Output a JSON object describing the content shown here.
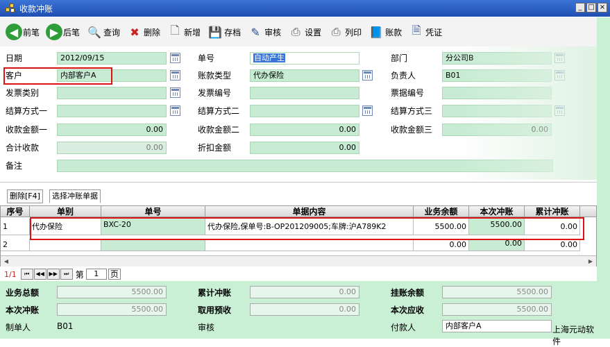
{
  "window": {
    "title": "收款冲账"
  },
  "toolbar": {
    "prev": "前笔",
    "next": "后笔",
    "query": "查询",
    "delete": "删除",
    "new": "新增",
    "save": "存档",
    "review": "审核",
    "settings": "设置",
    "print": "列印",
    "ledger": "账款",
    "voucher": "凭证"
  },
  "form": {
    "date_label": "日期",
    "date_value": "2012/09/15",
    "no_label": "单号",
    "no_value": "自动产生",
    "dept_label": "部门",
    "dept_value": "分公司B",
    "customer_label": "客户",
    "customer_value": "内部客户A",
    "acct_type_label": "账款类型",
    "acct_type_value": "代办保险",
    "owner_label": "负责人",
    "owner_value": "B01",
    "invoice_type_label": "发票类别",
    "invoice_type_value": "",
    "invoice_no_label": "发票编号",
    "invoice_no_value": "",
    "bill_no_label": "票据编号",
    "bill_no_value": "",
    "settle1_label": "结算方式一",
    "settle1_value": "",
    "settle2_label": "结算方式二",
    "settle2_value": "",
    "settle3_label": "结算方式三",
    "settle3_value": "",
    "amt1_label": "收款金额一",
    "amt1_value": "0.00",
    "amt2_label": "收款金额二",
    "amt2_value": "0.00",
    "amt3_label": "收款金额三",
    "amt3_value": "0.00",
    "total_label": "合计收款",
    "total_value": "0.00",
    "discount_label": "折扣金额",
    "discount_value": "0.00",
    "remark_label": "备注",
    "remark_value": ""
  },
  "tabs": {
    "delete_tab": "删除[F4]",
    "select_tab": "选择冲账单据"
  },
  "grid": {
    "headers": [
      "序号",
      "单别",
      "单号",
      "单据内容",
      "业务余额",
      "本次冲账",
      "累计冲账"
    ],
    "rows": [
      {
        "seq": "1",
        "type": "代办保险",
        "no": "BXC-20",
        "content": "代办保险,保单号:B-OP201209005;车牌:沪A789K2",
        "balance": "5500.00",
        "this": "5500.00",
        "cum": "0.00"
      },
      {
        "seq": "2",
        "type": "",
        "no": "",
        "content": "",
        "balance": "0.00",
        "this": "0.00",
        "cum": "0.00"
      }
    ]
  },
  "pager": {
    "page_text": "1/1",
    "di": "第",
    "page": "1",
    "ye": "页"
  },
  "summary": {
    "biz_total_label": "业务总额",
    "biz_total_value": "5500.00",
    "cum_label": "累计冲账",
    "cum_value": "0.00",
    "hang_label": "挂账余额",
    "hang_value": "5500.00",
    "this_label": "本次冲账",
    "this_value": "5500.00",
    "prepay_label": "取用预收",
    "prepay_value": "0.00",
    "due_label": "本次应收",
    "due_value": "5500.00",
    "maker_label": "制单人",
    "maker_value": "B01",
    "audit_label": "审核",
    "payer_label": "付款人",
    "payer_value": "内部客户A",
    "brand": "上海元动软件"
  }
}
